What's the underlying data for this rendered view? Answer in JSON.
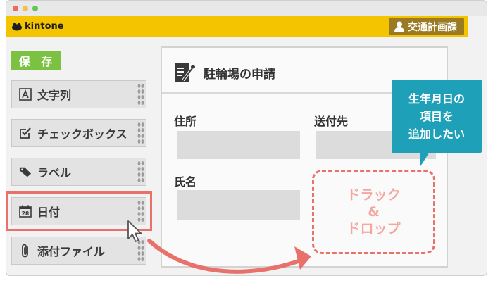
{
  "app": {
    "logo_text": "kintone",
    "department": "交通計画課"
  },
  "toolbar": {
    "save_label": "保 存"
  },
  "palette": [
    {
      "label": "文字列",
      "icon": "text-a-icon"
    },
    {
      "label": "チェックボックス",
      "icon": "checkbox-icon"
    },
    {
      "label": "ラベル",
      "icon": "tag-icon"
    },
    {
      "label": "日付",
      "icon": "calendar-icon",
      "icon_text": "28"
    },
    {
      "label": "添付ファイル",
      "icon": "paperclip-icon"
    }
  ],
  "form": {
    "title": "駐輪場の申請",
    "fields": [
      {
        "label": "住所"
      },
      {
        "label": "送付先"
      },
      {
        "label": "氏名"
      }
    ],
    "drop_zone": {
      "line1": "ドラック",
      "line2": "&",
      "line3": "ドロップ"
    }
  },
  "callout": {
    "line1": "生年月日の",
    "line2": "項目を",
    "line3": "追加したい"
  },
  "colors": {
    "header": "#f5c400",
    "department_bg": "#9a7b24",
    "save_button": "#7cc242",
    "accent": "#e9716b",
    "callout": "#1ea0b8",
    "palette_item": "#e3e3e3"
  }
}
